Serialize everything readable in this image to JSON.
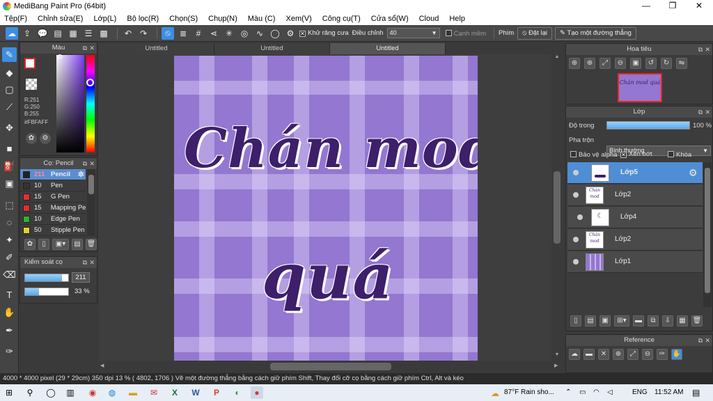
{
  "window": {
    "title": "MediBang Paint Pro (64bit)"
  },
  "menu": [
    "Tệp(F)",
    "Chỉnh sửa(E)",
    "Lớp(L)",
    "Bộ lọc(R)",
    "Chọn(S)",
    "Chụp(N)",
    "Màu (C)",
    "Xem(V)",
    "Công cụ(T)",
    "Cửa sổ(W)",
    "Cloud",
    "Help"
  ],
  "toolbar": {
    "antialias_label": "Khử răng cưa",
    "adjust_label": "Điều chỉnh",
    "adjust_value": "40",
    "soft_edge_label": "Cạnh mềm",
    "key_label": "Phím",
    "reset_label": "Đặt lại",
    "straight_line_label": "Tạo một đường thẳng"
  },
  "color_panel": {
    "title": "Màu",
    "r": "R:251",
    "g": "G:250",
    "b": "B:255",
    "hex": "#FBFAFF",
    "primary_color": "#fbfaff"
  },
  "brush_panel": {
    "title": "Cọ: Pencil",
    "items": [
      {
        "size": "211",
        "name": "Pencil",
        "color": "#222222",
        "selected": true
      },
      {
        "size": "10",
        "name": "Pen",
        "color": "#333333"
      },
      {
        "size": "15",
        "name": "G Pen",
        "color": "#e03030"
      },
      {
        "size": "15",
        "name": "Mapping Pe",
        "color": "#e03030"
      },
      {
        "size": "10",
        "name": "Edge Pen",
        "color": "#30b030"
      },
      {
        "size": "50",
        "name": "Stipple Pen",
        "color": "#e0d030"
      }
    ]
  },
  "control_panel": {
    "title": "Kiểm soát cọ",
    "size_value": "211",
    "opacity_value": "33 %",
    "size_fraction": 0.85,
    "opacity_fraction": 0.33
  },
  "tabs": [
    "Untitled",
    "Untitled",
    "Untitled"
  ],
  "canvas": {
    "line1": "Chán mod",
    "line2": "quá",
    "bg_color": "#9377d0"
  },
  "navigator": {
    "title": "Hoa tiêu",
    "thumb_text": "Chán mod quá"
  },
  "layer_panel": {
    "title": "Lớp",
    "opacity_label": "Độ trong",
    "opacity_value": "100 %",
    "blend_label": "Pha trộn",
    "blend_value": "Bình thường",
    "protect_alpha_label": "Bảo vệ alpha",
    "clip_label": "Xén bớt",
    "lock_label": "Khóa",
    "layers": [
      {
        "name": "Lớp5",
        "selected": true
      },
      {
        "name": "Lớp2"
      },
      {
        "name": "Lớp4"
      },
      {
        "name": "Lớp2"
      },
      {
        "name": "Lớp1"
      }
    ]
  },
  "reference_panel": {
    "title": "Reference"
  },
  "status": {
    "text": "4000 * 4000 pixel   (29 * 29cm)   350 dpi   13 %   ( 4802, 1706 )   Vẽ một đường thẳng bằng cách giữ phím Shift, Thay đổi cỡ cọ bằng cách giữ phím Ctrl, Alt và kéo"
  },
  "taskbar": {
    "weather": "87°F  Rain sho...",
    "lang": "ENG",
    "time": "11:52 AM"
  }
}
